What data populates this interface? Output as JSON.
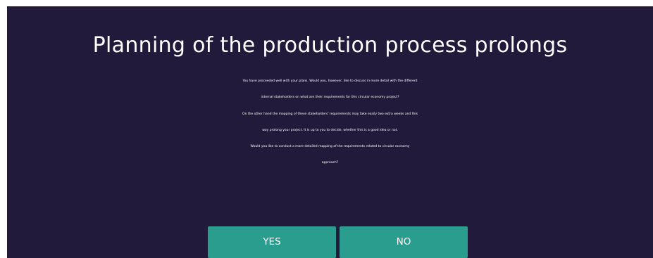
{
  "dialog": {
    "title": "Planning of the production process prolongs",
    "body_lines": [
      "You have proceeded well with your plans. Would you, however, like to discuss in more detail with the different",
      "internal stakeholders on what are their requirements for this circular economy project?",
      "On the other hand the mapping of these stakeholders' requirements may take easily two extra weeks and this",
      "way prolong your project. It is up to you to decide, whether this is a good idea or not.",
      "Would you like to conduct a more detailed mapping of the requirements related to circular economy",
      "approach?"
    ],
    "buttons": {
      "yes_label": "YES",
      "no_label": "NO"
    }
  },
  "colors": {
    "background": "#221a3a",
    "button": "#2a9d8f",
    "text": "#ffffff"
  }
}
